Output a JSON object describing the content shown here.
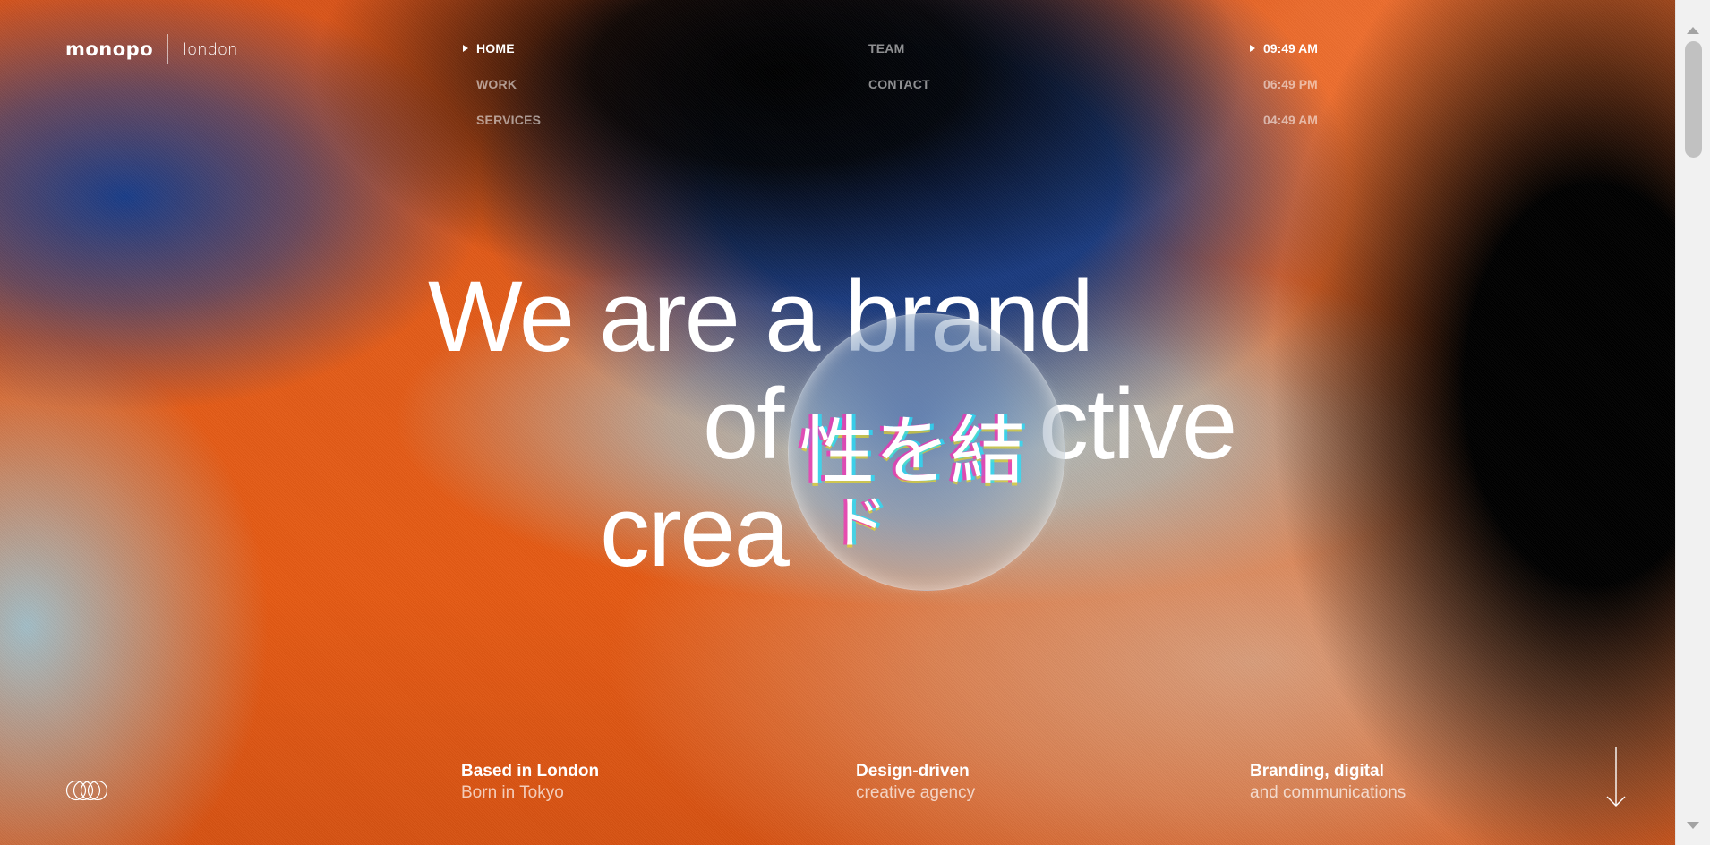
{
  "brand": {
    "name": "monopo",
    "city": "london"
  },
  "nav": {
    "items": [
      {
        "label": "HOME",
        "active": true
      },
      {
        "label": "WORK",
        "active": false
      },
      {
        "label": "SERVICES",
        "active": false
      },
      {
        "label": "TEAM",
        "active": false
      },
      {
        "label": "CONTACT",
        "active": false
      }
    ]
  },
  "times": [
    {
      "value": "09:49 AM",
      "active": true
    },
    {
      "value": "06:49 PM",
      "active": false
    },
    {
      "value": "04:49 AM",
      "active": false
    }
  ],
  "headline": {
    "line1": "We are a brand",
    "line2": "of",
    "line2_end": "ctive",
    "line3": "crea"
  },
  "lens": {
    "chars_row1": "性を結",
    "chars_row2": "ド"
  },
  "footer": [
    {
      "strong": "Based in London",
      "light": "Born in Tokyo"
    },
    {
      "strong": "Design-driven",
      "light": "creative agency"
    },
    {
      "strong": "Branding, digital",
      "light": "and communications"
    }
  ],
  "icons": {
    "brand_mark": "rings-logo-icon",
    "scroll": "arrow-down-icon"
  },
  "colors": {
    "orange": "#e35c19",
    "blue": "#1b3b7e",
    "black": "#000000",
    "text": "#ffffff"
  }
}
